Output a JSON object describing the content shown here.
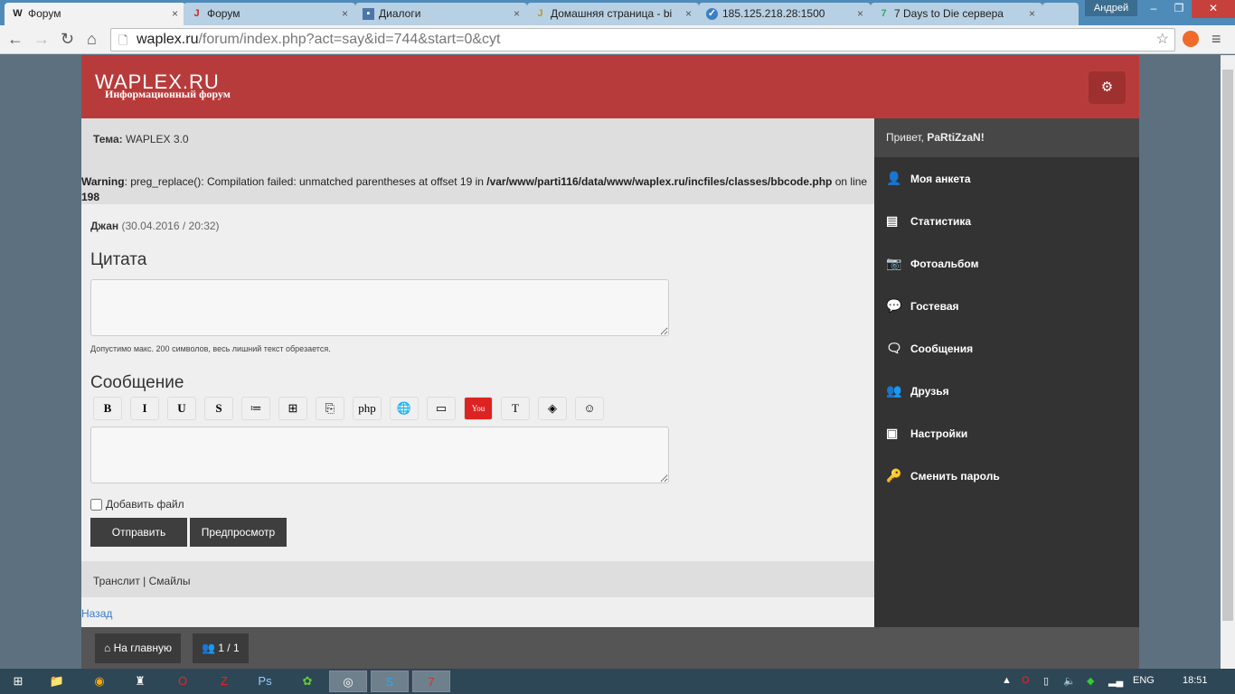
{
  "browser": {
    "tabs": [
      {
        "title": "Форум",
        "icon": "waplex-icon",
        "active": true
      },
      {
        "title": "Форум",
        "icon": "jcms-icon"
      },
      {
        "title": "Диалоги",
        "icon": "chat-icon"
      },
      {
        "title": "Домашняя страница - bi",
        "icon": "jbs-icon"
      },
      {
        "title": "185.125.218.28:1500",
        "icon": "check-icon"
      },
      {
        "title": "7 Days to Die сервера",
        "icon": "7days-icon"
      }
    ],
    "user": "Андрей",
    "url_host": "waplex.ru",
    "url_path": "/forum/index.php?act=say&id=744&start=0&cyt"
  },
  "header": {
    "logo": "WAPLEX.RU",
    "subtitle": "Информационный форум",
    "brand_color": "#b83b3b"
  },
  "topic": {
    "label": "Тема:",
    "value": "WAPLEX 3.0"
  },
  "warning": {
    "label": "Warning",
    "text": ": preg_replace(): Compilation failed: unmatched parentheses at offset 19 in ",
    "path": "/var/www/parti116/data/www/waplex.ru/incfiles/classes/bbcode.php",
    "on_line": " on line ",
    "line": "198"
  },
  "post": {
    "author": "Джан",
    "date": "(30.04.2016 / 20:32)"
  },
  "form": {
    "quote_title": "Цитата",
    "hint": "Допустимо макс. 200 символов, весь лишний текст обрезается.",
    "message_title": "Сообщение",
    "add_file": "Добавить файл",
    "submit": "Отправить",
    "preview": "Предпросмотр",
    "bbcode": [
      {
        "label": "B",
        "icon": "bold-icon"
      },
      {
        "label": "I",
        "icon": "italic-icon"
      },
      {
        "label": "U",
        "icon": "underline-icon"
      },
      {
        "label": "S",
        "icon": "strike-icon"
      },
      {
        "label": "≔",
        "icon": "list-icon"
      },
      {
        "label": "⊞",
        "icon": "spoiler-icon"
      },
      {
        "label": "⎘",
        "icon": "copy-icon"
      },
      {
        "label": "php",
        "icon": "php-icon"
      },
      {
        "label": "🌐",
        "icon": "link-icon"
      },
      {
        "label": "▭",
        "icon": "image-icon"
      },
      {
        "label": "You",
        "icon": "youtube-icon"
      },
      {
        "label": "T",
        "icon": "text-color-icon"
      },
      {
        "label": "◈",
        "icon": "bg-color-icon"
      },
      {
        "label": "☺",
        "icon": "smiley-icon"
      }
    ]
  },
  "links": {
    "translit": "Транслит",
    "sep": " | ",
    "smiles": "Смайлы",
    "back": "Назад"
  },
  "sidebar": {
    "greeting": "Привет, ",
    "username": "PaRtiZzaN!",
    "items": [
      {
        "label": "Моя анкета",
        "icon": "user-icon",
        "glyph": "👤"
      },
      {
        "label": "Статистика",
        "icon": "stats-icon",
        "glyph": "▤"
      },
      {
        "label": "Фотоальбом",
        "icon": "camera-icon",
        "glyph": "📷"
      },
      {
        "label": "Гостевая",
        "icon": "guestbook-icon",
        "glyph": "💬"
      },
      {
        "label": "Сообщения",
        "icon": "messages-icon",
        "glyph": "🗨"
      },
      {
        "label": "Друзья",
        "icon": "friends-icon",
        "glyph": "👥"
      },
      {
        "label": "Настройки",
        "icon": "settings-icon",
        "glyph": "▣"
      },
      {
        "label": "Сменить пароль",
        "icon": "key-icon",
        "glyph": "🔑"
      }
    ]
  },
  "footer": {
    "home": "На главную",
    "online": "1 / 1"
  },
  "taskbar": {
    "lang": "ENG",
    "time": "18:51"
  }
}
